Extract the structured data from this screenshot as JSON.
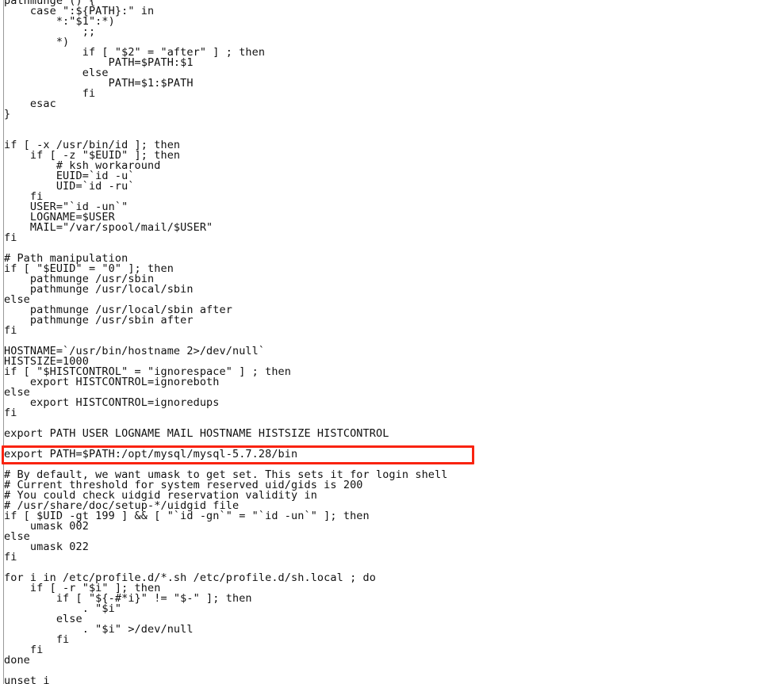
{
  "document": {
    "kind": "shell-script",
    "background_color": "#ffffff",
    "text_color": "#111111",
    "gutter_rule_color": "#9a9a9a"
  },
  "annotation": {
    "type": "rectangle-highlight",
    "color": "#f92310",
    "target_line_index": 43,
    "target_line_text": "export PATH=$PATH:/opt/mysql/mysql-5.7.28/bin"
  },
  "code": {
    "lines": [
      "pathmunge () {",
      "    case \":${PATH}:\" in",
      "        *:\"$1\":*)",
      "            ;;",
      "        *)",
      "            if [ \"$2\" = \"after\" ] ; then",
      "                PATH=$PATH:$1",
      "            else",
      "                PATH=$1:$PATH",
      "            fi",
      "    esac",
      "}",
      "",
      "",
      "if [ -x /usr/bin/id ]; then",
      "    if [ -z \"$EUID\" ]; then",
      "        # ksh workaround",
      "        EUID=`id -u`",
      "        UID=`id -ru`",
      "    fi",
      "    USER=\"`id -un`\"",
      "    LOGNAME=$USER",
      "    MAIL=\"/var/spool/mail/$USER\"",
      "fi",
      "",
      "# Path manipulation",
      "if [ \"$EUID\" = \"0\" ]; then",
      "    pathmunge /usr/sbin",
      "    pathmunge /usr/local/sbin",
      "else",
      "    pathmunge /usr/local/sbin after",
      "    pathmunge /usr/sbin after",
      "fi",
      "",
      "HOSTNAME=`/usr/bin/hostname 2>/dev/null`",
      "HISTSIZE=1000",
      "if [ \"$HISTCONTROL\" = \"ignorespace\" ] ; then",
      "    export HISTCONTROL=ignoreboth",
      "else",
      "    export HISTCONTROL=ignoredups",
      "fi",
      "",
      "export PATH USER LOGNAME MAIL HOSTNAME HISTSIZE HISTCONTROL",
      "",
      "export PATH=$PATH:/opt/mysql/mysql-5.7.28/bin",
      "",
      "# By default, we want umask to get set. This sets it for login shell",
      "# Current threshold for system reserved uid/gids is 200",
      "# You could check uidgid reservation validity in",
      "# /usr/share/doc/setup-*/uidgid file",
      "if [ $UID -gt 199 ] && [ \"`id -gn`\" = \"`id -un`\" ]; then",
      "    umask 002",
      "else",
      "    umask 022",
      "fi",
      "",
      "for i in /etc/profile.d/*.sh /etc/profile.d/sh.local ; do",
      "    if [ -r \"$i\" ]; then",
      "        if [ \"${-#*i}\" != \"$-\" ]; then",
      "            . \"$i\"",
      "        else",
      "            . \"$i\" >/dev/null",
      "        fi",
      "    fi",
      "done",
      "",
      "unset i"
    ]
  }
}
